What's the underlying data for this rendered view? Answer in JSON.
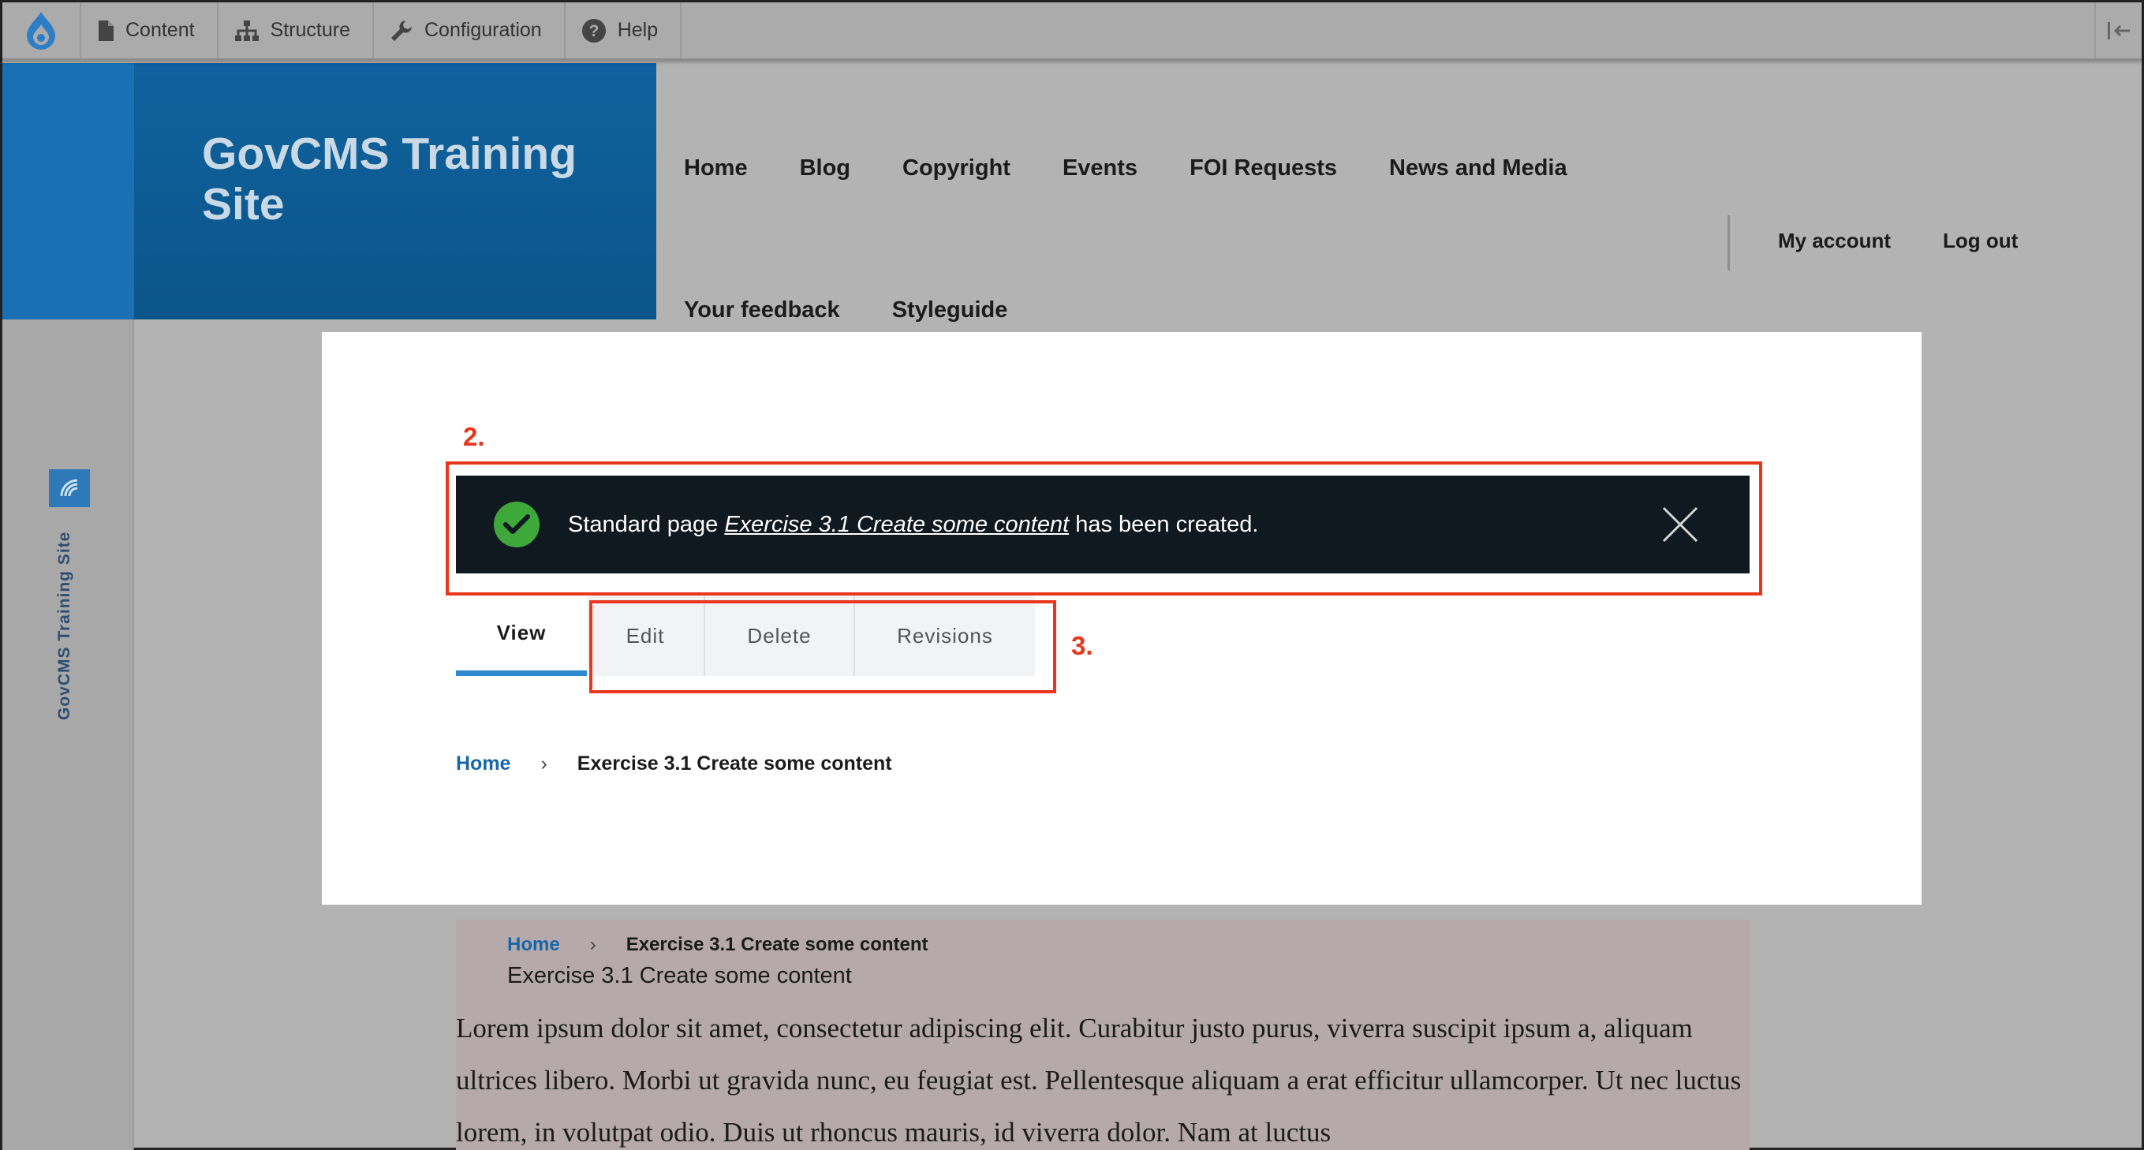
{
  "toolbar": {
    "logo_icon": "drupal-drop-icon",
    "items": [
      {
        "label": "Content",
        "icon": "document-icon"
      },
      {
        "label": "Structure",
        "icon": "sitemap-icon"
      },
      {
        "label": "Configuration",
        "icon": "wrench-icon"
      },
      {
        "label": "Help",
        "icon": "help-icon"
      }
    ],
    "collapse_icon": "collapse-sidebar-icon"
  },
  "sidebar": {
    "badge_icon": "wifi-icon",
    "label": "GovCMS Training Site"
  },
  "header": {
    "site_name": "GovCMS Training Site",
    "main_nav": [
      "Home",
      "Blog",
      "Copyright",
      "Events",
      "FOI Requests",
      "News and Media"
    ],
    "main_nav_row2": [
      "Your feedback",
      "Styleguide"
    ],
    "account_nav": [
      "My account",
      "Log out"
    ]
  },
  "annotations": {
    "step_2": "2.",
    "step_3": "3."
  },
  "status_message": {
    "prefix": "Standard page ",
    "link": "Exercise 3.1 Create some content",
    "suffix": " has been created.",
    "icon": "check-circle-icon",
    "close_icon": "close-icon"
  },
  "tabs": [
    {
      "label": "View",
      "active": true
    },
    {
      "label": "Edit",
      "active": false
    },
    {
      "label": "Delete",
      "active": false
    },
    {
      "label": "Revisions",
      "active": false
    }
  ],
  "breadcrumb": {
    "home": "Home",
    "separator": "›",
    "current": "Exercise 3.1 Create some content"
  },
  "content": {
    "breadcrumb_home": "Home",
    "breadcrumb_current": "Exercise 3.1 Create some content",
    "title": "Exercise 3.1 Create some content",
    "body": "Lorem ipsum dolor sit amet, consectetur adipiscing elit. Curabitur justo purus, viverra suscipit ipsum a, aliquam ultrices libero. Morbi ut gravida nunc, eu feugiat est. Pellentesque aliquam a erat efficitur ullamcorper. Ut nec luctus lorem, in volutpat odio. Duis ut rhoncus mauris, id viverra dolor. Nam at luctus"
  },
  "colors": {
    "brand_blue": "#0f629f",
    "annotation_red": "#e8371c",
    "status_bg": "#101820",
    "success_green": "#3ea83a",
    "tab_active_underline": "#2d8ad1"
  }
}
